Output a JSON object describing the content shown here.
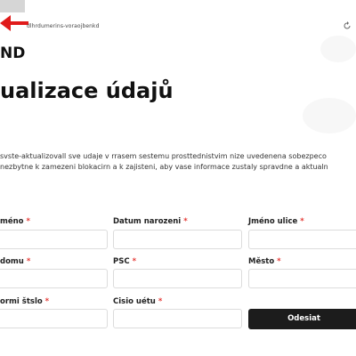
{
  "browser": {
    "url": "dlhrdumerins-voraojbenkd"
  },
  "header": {
    "bank_name": "ND"
  },
  "main": {
    "title": "ualizace údajů",
    "description_lines": [
      "svste-aktualizovall sve udaje v rrasem sestemu prosttednistvim nize uvedenena sobezpeco",
      "  nezbytne k zamezeni blokacirn a k zajisteni, aby vase informace zustaly spravdne a aktualn"
    ]
  },
  "form": {
    "required_mark": "*",
    "fields": [
      {
        "label": "méno",
        "value": ""
      },
      {
        "label": "Datum narozeni",
        "value": ""
      },
      {
        "label": "Jméno ulice",
        "value": ""
      },
      {
        "label": "domu",
        "value": ""
      },
      {
        "label": "PSC",
        "value": ""
      },
      {
        "label": "Město",
        "value": ""
      },
      {
        "label": "ormi štslo",
        "value": ""
      },
      {
        "label": "Cisio uétu",
        "value": ""
      }
    ],
    "submit_label": "Odesiat"
  },
  "colors": {
    "accent_arrow": "#e01b1b",
    "required": "#e53935",
    "button_bg": "#1c1c1c"
  }
}
